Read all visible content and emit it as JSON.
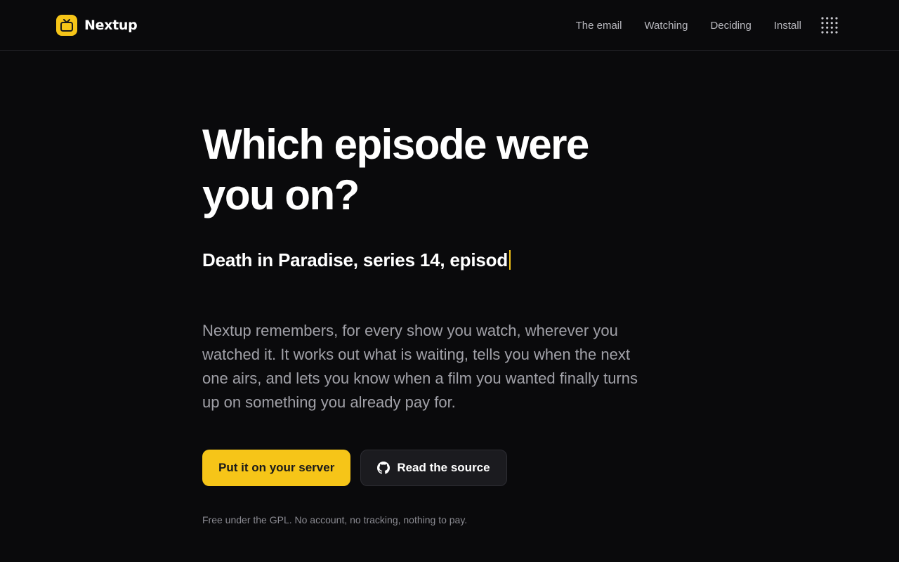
{
  "brand": {
    "name": "Nextup",
    "logo_icon": "tv-icon",
    "accent_color": "#f6c518"
  },
  "nav": {
    "links": [
      {
        "label": "The email"
      },
      {
        "label": "Watching"
      },
      {
        "label": "Deciding"
      },
      {
        "label": "Install"
      }
    ],
    "apps_icon": "grid-dots-icon"
  },
  "hero": {
    "headline": "Which episode were you on?",
    "typed_text": "Death in Paradise, series 14, episod",
    "description": "Nextup remembers, for every show you watch, wherever you watched it. It works out what is waiting, tells you when the next one airs, and lets you know when a film you wanted finally turns up on something you already pay for.",
    "primary_button": "Put it on your server",
    "secondary_button": "Read the source",
    "secondary_icon": "github-icon",
    "footnote": "Free under the GPL. No account, no tracking, nothing to pay."
  }
}
